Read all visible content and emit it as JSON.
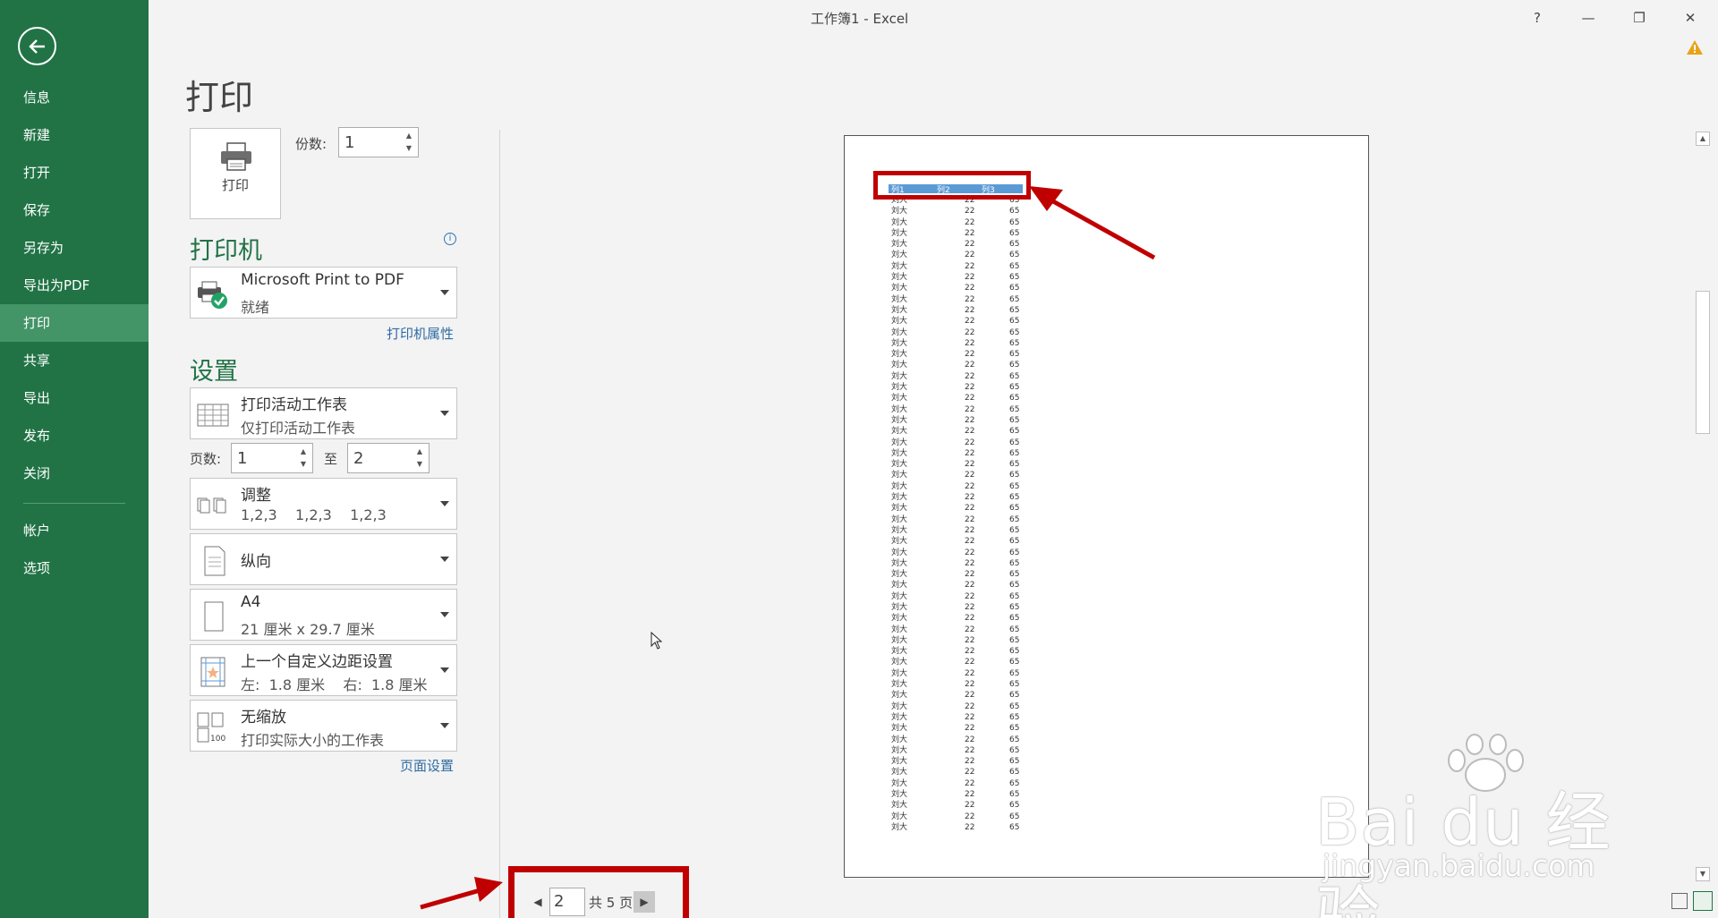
{
  "app": {
    "window_title": "工作簿1 - Excel",
    "help": "?",
    "minimize": "—",
    "restore": "❐",
    "close": "✕"
  },
  "sidebar": {
    "items": [
      {
        "label": "信息"
      },
      {
        "label": "新建"
      },
      {
        "label": "打开"
      },
      {
        "label": "保存"
      },
      {
        "label": "另存为"
      },
      {
        "label": "导出为PDF"
      },
      {
        "label": "打印"
      },
      {
        "label": "共享"
      },
      {
        "label": "导出"
      },
      {
        "label": "发布"
      },
      {
        "label": "关闭"
      },
      {
        "label": "帐户"
      },
      {
        "label": "选项"
      }
    ],
    "active": "打印"
  },
  "page_title": "打印",
  "print_button": {
    "label": "打印"
  },
  "copies": {
    "label": "份数:",
    "value": "1"
  },
  "printer": {
    "section_title": "打印机",
    "name": "Microsoft Print to PDF",
    "status": "就绪",
    "properties_link": "打印机属性"
  },
  "settings": {
    "section_title": "设置",
    "what": {
      "title": "打印活动工作表",
      "subtitle": "仅打印活动工作表"
    },
    "pages": {
      "label": "页数:",
      "from": "1",
      "to_label": "至",
      "to": "2"
    },
    "collate": {
      "title": "调整",
      "subtitle": "1,2,3    1,2,3    1,2,3"
    },
    "orientation": {
      "title": "纵向"
    },
    "paper": {
      "title": "A4",
      "subtitle": "21 厘米 x 29.7 厘米"
    },
    "margins": {
      "title": "上一个自定义边距设置",
      "subtitle": "左:  1.8 厘米    右:  1.8 厘米"
    },
    "scaling": {
      "title": "无缩放",
      "subtitle": "打印实际大小的工作表",
      "icon_text": "100"
    },
    "page_setup_link": "页面设置"
  },
  "preview": {
    "headers": [
      "列1",
      "列2",
      "列3"
    ],
    "row": [
      "刘大",
      "22",
      "65"
    ],
    "row_count": 58
  },
  "page_nav": {
    "current": "2",
    "total_text": "共 5 页"
  },
  "watermark": {
    "main": "Bai du 经验",
    "sub": "jingyan.baidu.com"
  },
  "colors": {
    "sidebar": "#217346",
    "sidebar_active": "#439467",
    "accent": "#217346",
    "annotation": "#c00000",
    "header_fill": "#5b9bd5"
  }
}
